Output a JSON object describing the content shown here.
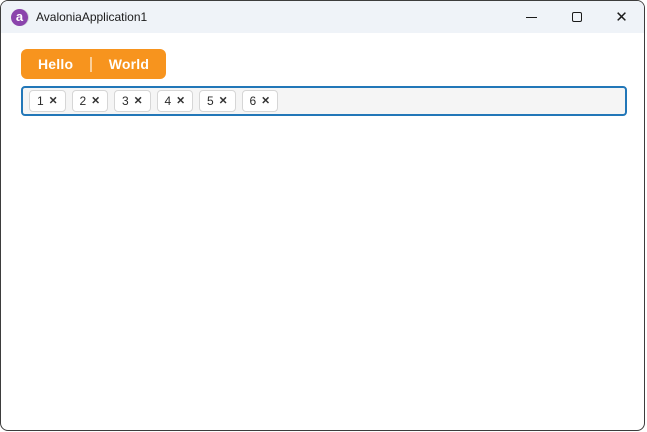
{
  "window": {
    "title": "AvaloniaApplication1",
    "logo_letter": "a"
  },
  "titlebar": {
    "close_glyph": "✕"
  },
  "tabs": [
    {
      "label": "Hello"
    },
    {
      "label": "World"
    }
  ],
  "tag_box": {
    "chips": [
      {
        "value": "1"
      },
      {
        "value": "2"
      },
      {
        "value": "3"
      },
      {
        "value": "4"
      },
      {
        "value": "5"
      },
      {
        "value": "6"
      }
    ],
    "remove_glyph": "✕"
  },
  "colors": {
    "tab_orange": "#F7941E",
    "focus_border_blue": "#2277B8",
    "titlebar_bg": "#EFF3F8",
    "logo_purple": "#8B44AC",
    "window_border": "#3D3D3D"
  }
}
